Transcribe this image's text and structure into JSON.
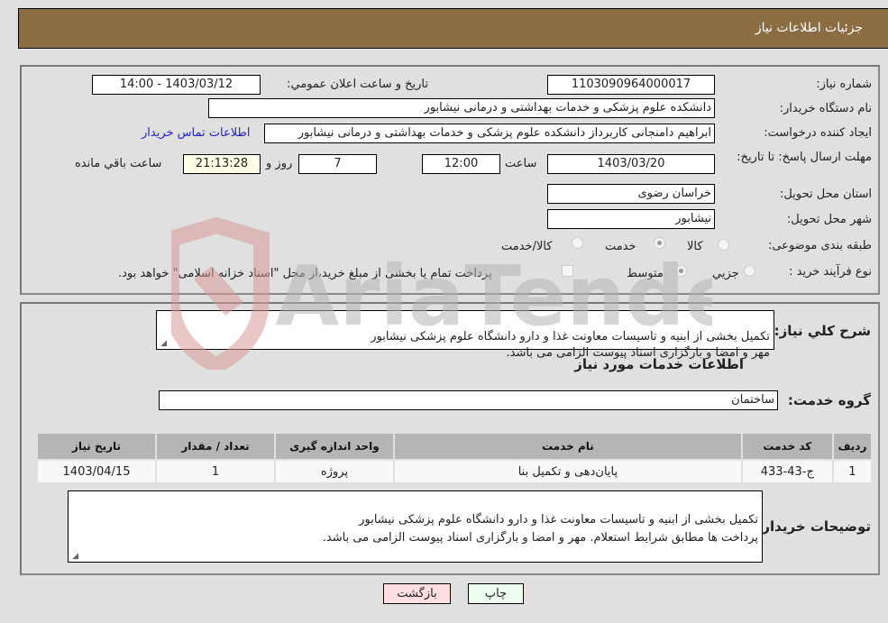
{
  "header": {
    "title": "جزئیات اطلاعات نیاز"
  },
  "colors": {
    "header_bg": "#8c6d43",
    "link": "#2222cc",
    "back_button_bg": "#ffdfdf",
    "print_button_bg": "#efffef"
  },
  "fields": {
    "need_number": {
      "label": "شماره نیاز:",
      "value": "1103090964000017"
    },
    "announce_datetime": {
      "label": "تاریخ و ساعت اعلان عمومي:",
      "value": "1403/03/12 - 14:00"
    },
    "buyer_org": {
      "label": "نام دستگاه خریدار:",
      "value": "دانشکده علوم پزشکی و خدمات بهداشتی و درمانی نیشابور"
    },
    "creator": {
      "label": "ایجاد کننده درخواست:",
      "value": "ابراهیم دامنجانی  کاربرداز دانشکده علوم پزشکی و خدمات بهداشتی و درمانی نیشابور"
    },
    "buyer_contact_link": "اطلاعات تماس خریدار",
    "deadline": {
      "label": "مهلت ارسال پاسخ: تا تاریخ:",
      "date": "1403/03/20",
      "time_label": "ساعت",
      "time": "12:00",
      "days": "7",
      "days_label": "روز و",
      "remaining": "21:13:28",
      "remaining_label": "ساعت باقي مانده"
    },
    "province": {
      "label": "استان محل تحویل:",
      "value": "خراسان رضوی"
    },
    "city": {
      "label": "شهر محل تحویل:",
      "value": "نیشابور"
    },
    "category": {
      "label": "طبقه بندی موضوعی:",
      "options": [
        {
          "label": "کالا",
          "checked": false
        },
        {
          "label": "خدمت",
          "checked": true
        },
        {
          "label": "کالا/خدمت",
          "checked": false
        }
      ]
    },
    "purchase_type": {
      "label": "نوع فرآیند خرید :",
      "options": [
        {
          "label": "جزيي",
          "checked": false
        },
        {
          "label": "متوسط",
          "checked": true
        }
      ],
      "treasury_note": "پرداخت تمام یا بخشی از مبلغ خرید،از محل \"اسناد خزانه اسلامی\" خواهد بود."
    }
  },
  "summary": {
    "label": "شرح کلي نیاز:",
    "text": "تکمیل بخشی از ابنیه و تاسیسات معاونت غذا و دارو دانشگاه علوم پزشکی نیشابور\n مهر و امضا و بارگزاری اسناد پیوست الزامی می باشد."
  },
  "services": {
    "section_title": "اطلاعات خدمات مورد نیاز",
    "group_label": "گروه خدمت:",
    "group_value": "ساختمان",
    "columns": [
      "ردیف",
      "کد خدمت",
      "نام خدمت",
      "واحد اندازه گیری",
      "تعداد / مقدار",
      "تاریخ نیاز"
    ],
    "rows": [
      [
        "1",
        "ج-43-433",
        "پایان‌دهی و تکمیل بنا",
        "پروژه",
        "1",
        "1403/04/15"
      ]
    ]
  },
  "buyer_notes": {
    "label": "توضیحات خریدار:",
    "text": "تکمیل بخشی از ابنیه و تاسیسات معاونت غذا و دارو دانشگاه علوم پزشکی نیشابور\nپرداخت ها مطابق شرایط استعلام. مهر و امضا و بارگزاری اسناد پیوست الزامی می باشد."
  },
  "buttons": {
    "print": "چاپ",
    "back": "بازگشت"
  },
  "watermark": {
    "text": "AriaTender.neT"
  }
}
